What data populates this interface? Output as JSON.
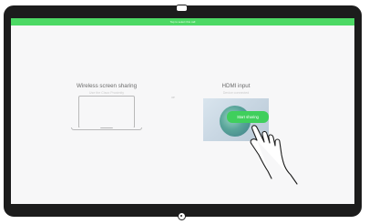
{
  "status_bar": {
    "text": "Tap to select this call"
  },
  "wireless": {
    "title": "Wireless screen sharing",
    "subtitle": "Use the Cisco Proximity app on your device"
  },
  "separator": {
    "text": "or"
  },
  "hdmi": {
    "title": "HDMI input",
    "subtitle": "Device connected",
    "start_button_label": "Start sharing"
  },
  "colors": {
    "accent_green": "#4cd964",
    "button_green": "#3fcf5c",
    "frame": "#1c1c1c",
    "screen_bg": "#f7f7f8"
  },
  "icons": {
    "camera": "camera-icon",
    "home": "home-button-icon",
    "laptop": "laptop-icon",
    "hand": "pointing-hand-icon"
  }
}
